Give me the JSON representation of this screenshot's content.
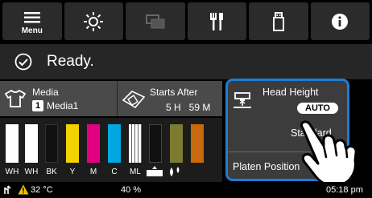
{
  "toolbar": {
    "menu_label": "Menu",
    "icons": [
      "menu-icon",
      "maintenance-icon",
      "print-queue-icon",
      "tools-icon",
      "usb-icon",
      "info-icon"
    ]
  },
  "status": {
    "text": "Ready."
  },
  "media": {
    "label": "Media",
    "slot": "1",
    "name": "Media1"
  },
  "starts_after": {
    "label": "Starts After",
    "time": "5 H   59 M"
  },
  "inks": {
    "labels": [
      "WH",
      "WH",
      "BK",
      "Y",
      "M",
      "C",
      "ML"
    ],
    "colors": {
      "WH": "#ffffff",
      "BK": "#111111",
      "Y": "#f3d200",
      "M": "#e3007f",
      "C": "#00a7e1",
      "ML": "#b0b0b0",
      "OL": "#8a8a2e",
      "OR": "#d4700e"
    }
  },
  "head_height": {
    "label": "Head Height",
    "mode": "AUTO",
    "value": "Standard"
  },
  "platen": {
    "label": "Platen Position"
  },
  "bottom": {
    "temperature": "32 °C",
    "humidity": "40 %",
    "time": "05:18 pm"
  },
  "accent": "#1f7cd6"
}
